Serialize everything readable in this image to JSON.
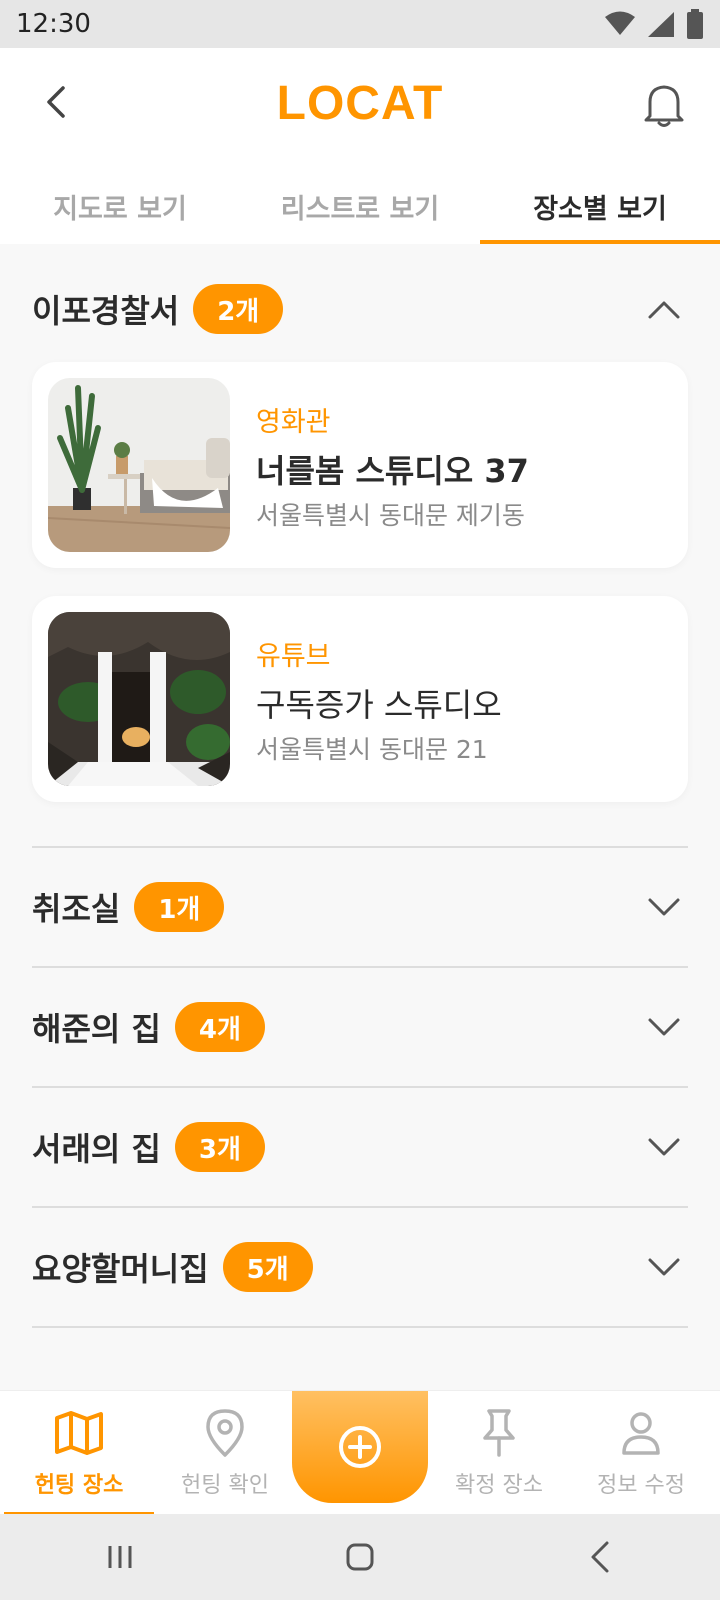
{
  "status_bar": {
    "time": "12:30"
  },
  "header": {
    "title": "LOCAT"
  },
  "tabs": [
    {
      "label": "지도로 보기"
    },
    {
      "label": "리스트로 보기"
    },
    {
      "label": "장소별 보기"
    }
  ],
  "groups": [
    {
      "title": "이포경찰서",
      "count": "2개",
      "expanded": true,
      "places": [
        {
          "category": "영화관",
          "name": "너를봄 스튜디오 37",
          "address": "서울특별시 동대문 제기동"
        },
        {
          "category": "유튜브",
          "name": "구독증가 스튜디오",
          "address": "서울특별시 동대문  21"
        }
      ]
    },
    {
      "title": "취조실",
      "count": "1개",
      "expanded": false
    },
    {
      "title": "해준의 집",
      "count": "4개",
      "expanded": false
    },
    {
      "title": "서래의 집",
      "count": "3개",
      "expanded": false
    },
    {
      "title": "요양할머니집",
      "count": "5개",
      "expanded": false
    }
  ],
  "bottom_nav": [
    {
      "label": "헌팅 장소",
      "icon": "map-icon",
      "active": true
    },
    {
      "label": "헌팅 확인",
      "icon": "location-pin-icon",
      "active": false
    },
    {
      "label": "",
      "icon": "add-circle-icon",
      "active": false
    },
    {
      "label": "확정 장소",
      "icon": "pushpin-icon",
      "active": false
    },
    {
      "label": "정보 수정",
      "icon": "user-icon",
      "active": false
    }
  ],
  "colors": {
    "accent": "#ff9500",
    "text": "#2b2b2b",
    "muted": "#a8a8a8"
  }
}
